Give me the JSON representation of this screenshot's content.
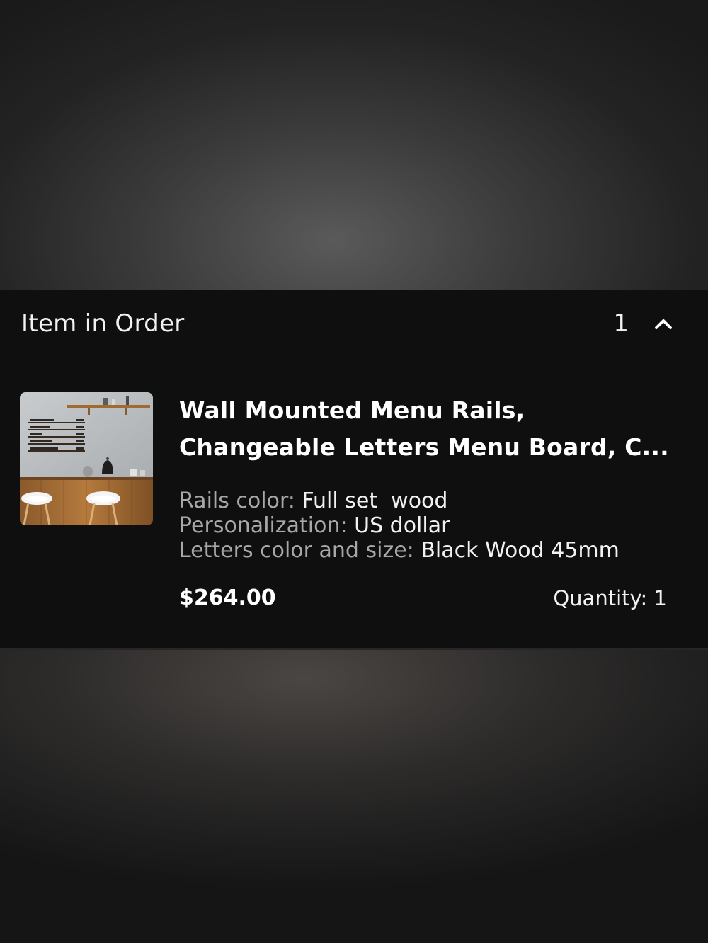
{
  "order_panel": {
    "title": "Item in Order",
    "item_count": "1",
    "toggle_icon": "chevron-up-icon"
  },
  "item": {
    "title_line1": "Wall Mounted Menu Rails,",
    "title_line2": "Changeable Letters Menu Board, C...",
    "attributes": [
      {
        "label": "Rails color: ",
        "value": "Full set  wood"
      },
      {
        "label": "Personalization: ",
        "value": "US dollar"
      },
      {
        "label": "Letters color and size: ",
        "value": "Black Wood 45mm"
      }
    ],
    "price": "$264.00",
    "quantity": "Quantity: 1",
    "thumbnail_menu": [
      "AMERICANO",
      "ESPRESSO",
      "LATTE",
      "CAPPUCCINO",
      "HOT CHOCOLATE"
    ]
  },
  "colors": {
    "sheet_background": "#0f0f0f",
    "primary_text": "#ffffff",
    "secondary_text": "#a8a8a8"
  }
}
